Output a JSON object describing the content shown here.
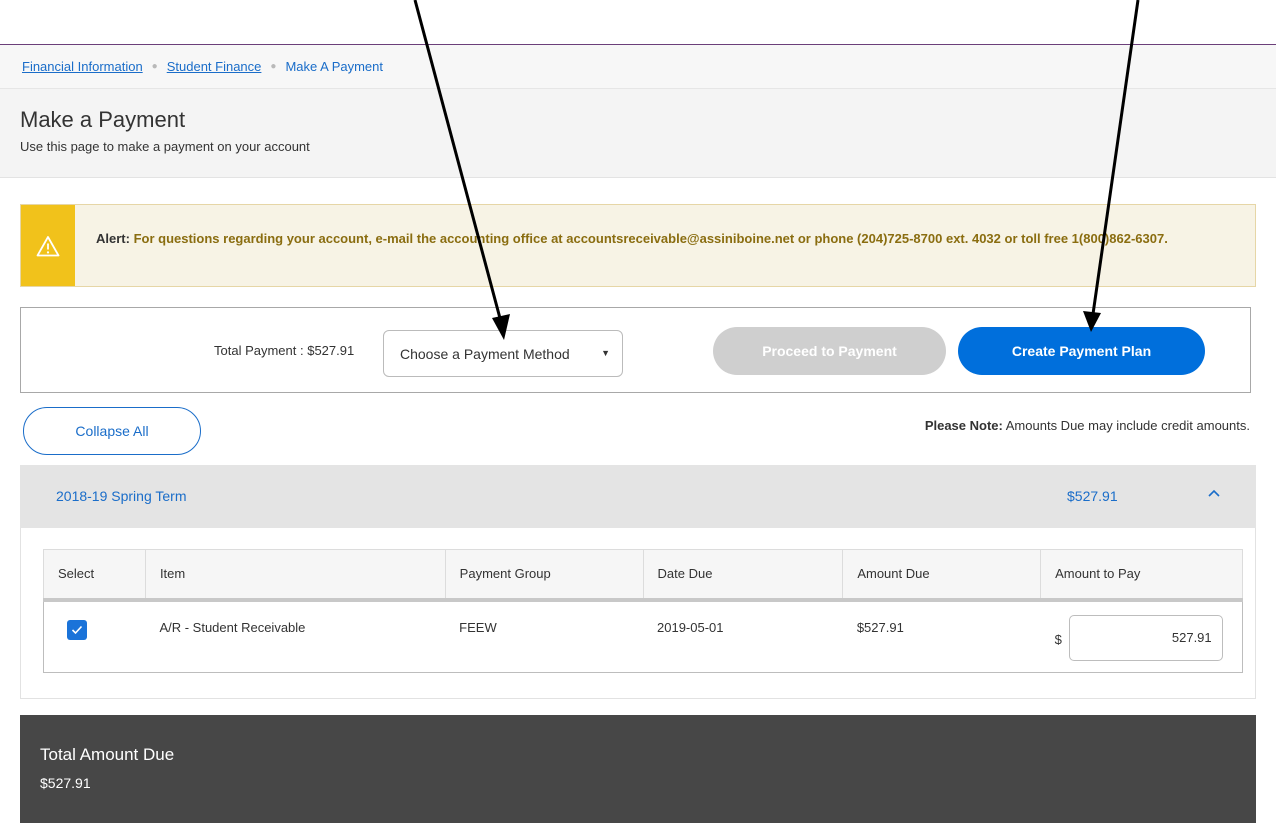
{
  "breadcrumb": {
    "items": [
      "Financial Information",
      "Student Finance"
    ],
    "current": "Make A Payment"
  },
  "header": {
    "title": "Make a Payment",
    "subtitle": "Use this page to make a payment on your account"
  },
  "alert": {
    "label": "Alert:",
    "text": "For questions regarding your account, e-mail the accounting office at accountsreceivable@assiniboine.net or phone (204)725-8700 ext. 4032 or toll free 1(800)862-6307.",
    "icon": "warning-icon",
    "color": "#f1c21b"
  },
  "payment_bar": {
    "total_label": "Total Payment : $527.91",
    "method_select": "Choose a Payment Method",
    "proceed_label": "Proceed to Payment",
    "create_plan_label": "Create Payment Plan"
  },
  "controls": {
    "collapse_label": "Collapse All",
    "note_label": "Please Note:",
    "note_text": "Amounts Due may include credit amounts."
  },
  "term": {
    "title": "2018-19 Spring Term",
    "amount": "$527.91"
  },
  "table": {
    "headers": [
      "Select",
      "Item",
      "Payment Group",
      "Date Due",
      "Amount Due",
      "Amount to Pay"
    ],
    "rows": [
      {
        "selected": true,
        "item": "A/R - Student Receivable",
        "group": "FEEW",
        "date_due": "2019-05-01",
        "amount_due": "$527.91",
        "currency": "$",
        "amount_to_pay": "527.91"
      }
    ]
  },
  "total_due": {
    "label": "Total Amount Due",
    "value": "$527.91"
  },
  "colors": {
    "accent": "#006fdc",
    "link": "#1a6dc9",
    "disabled_button": "#cfcfcf",
    "footer_bg": "#474747"
  }
}
